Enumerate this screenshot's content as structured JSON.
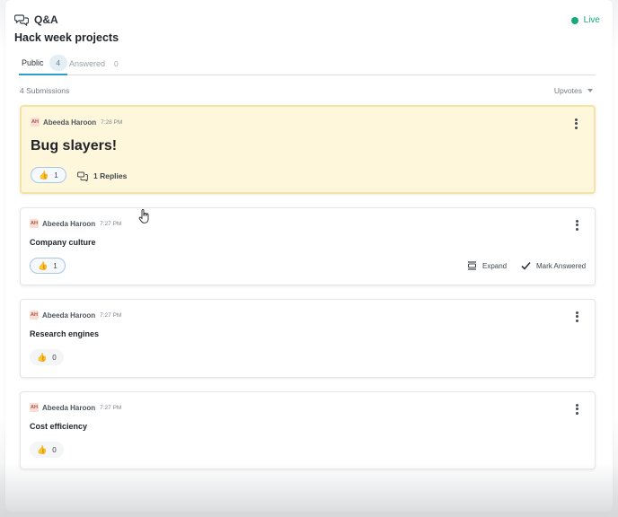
{
  "app": {
    "icon": "qa-bubbles-icon",
    "title": "Q&A",
    "status": "Live",
    "status_color": "#19a974"
  },
  "page_title": "Hack week projects",
  "tabs": [
    {
      "label": "Public",
      "count": "4",
      "active": true
    },
    {
      "label": "Answered",
      "count": "0",
      "active": false
    }
  ],
  "submissions_label": "4 Submissions",
  "sort": {
    "label": "Upvotes",
    "icon": "chevron-down-icon"
  },
  "questions": [
    {
      "initials": "AH",
      "author": "Abeeda Haroon",
      "time": "7:28 PM",
      "text": "Bug slayers!",
      "upvotes": "1",
      "replies": "1 Replies",
      "highlighted": true
    },
    {
      "initials": "AH",
      "author": "Abeeda Haroon",
      "time": "7:27 PM",
      "text": "Company culture",
      "upvotes": "1",
      "expand": "Expand",
      "mark_answered": "Mark Answered"
    },
    {
      "initials": "AH",
      "author": "Abeeda Haroon",
      "time": "7:27 PM",
      "text": "Research engines",
      "upvotes": "0"
    },
    {
      "initials": "AH",
      "author": "Abeeda Haroon",
      "time": "7:27 PM",
      "text": "Cost efficiency",
      "upvotes": "0"
    }
  ],
  "colors": {
    "highlight_bg": "#fff7dc",
    "accent": "#2f9bcf"
  }
}
